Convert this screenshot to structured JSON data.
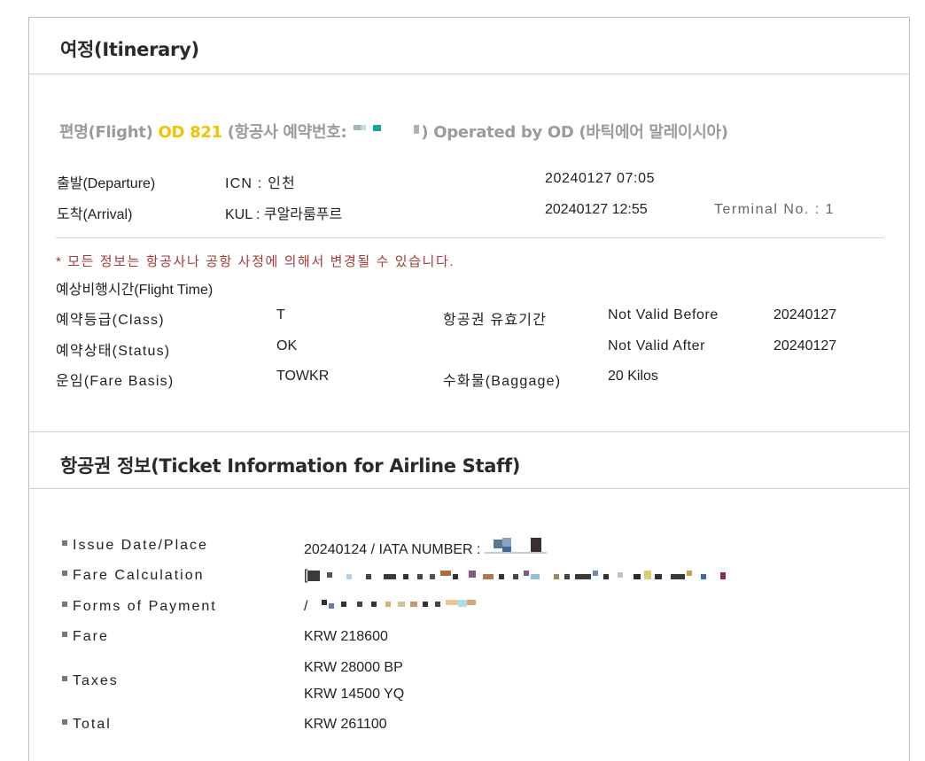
{
  "itinerary": {
    "title": "여정(Itinerary)",
    "flight": {
      "prefix": "편명(Flight) ",
      "number": "OD 821",
      "booking_label": " (항공사 예약번호: ",
      "operated": ") Operated by OD (바틱에어 말레이시아)"
    },
    "departure": {
      "label": "출발(Departure)",
      "place": "ICN : 인천",
      "datetime": "20240127 07:05"
    },
    "arrival": {
      "label": "도착(Arrival)",
      "place": "KUL : 쿠알라룸푸르",
      "datetime": "20240127 12:55",
      "terminal": "Terminal No. : 1"
    },
    "notice": "* 모든 정보는 항공사나 공항 사정에 의해서 변경될 수 있습니다.",
    "flight_time_label": "예상비행시간(Flight Time)",
    "class": {
      "label": "예약등급(Class)",
      "value": "T"
    },
    "status": {
      "label": "예약상태(Status)",
      "value": "OK"
    },
    "fare_basis": {
      "label": "운임(Fare Basis)",
      "value": "TOWKR"
    },
    "validity_label": "항공권 유효기간",
    "not_valid_before": {
      "label": "Not Valid Before",
      "value": "20240127"
    },
    "not_valid_after": {
      "label": "Not Valid After",
      "value": "20240127"
    },
    "baggage": {
      "label": "수화물(Baggage)",
      "value": "20 Kilos"
    }
  },
  "ticket": {
    "title": "항공권 정보(Ticket Information for Airline Staff)",
    "issue": {
      "label": "Issue Date/Place",
      "value": "20240124 / IATA NUMBER : "
    },
    "fare_calc": {
      "label": "Fare Calculation",
      "value": "["
    },
    "forms_of_payment": {
      "label": "Forms of Payment",
      "value": "/"
    },
    "fare": {
      "label": "Fare",
      "value": "KRW 218600"
    },
    "taxes": {
      "label": "Taxes",
      "values": [
        "KRW 28000 BP",
        "KRW 14500 YQ"
      ]
    },
    "total": {
      "label": "Total",
      "value": "KRW 261100"
    }
  },
  "colors": {
    "flight_number": "#f2c200",
    "notice_text": "#a63a3a",
    "muted_heading": "#9b9b9b"
  }
}
